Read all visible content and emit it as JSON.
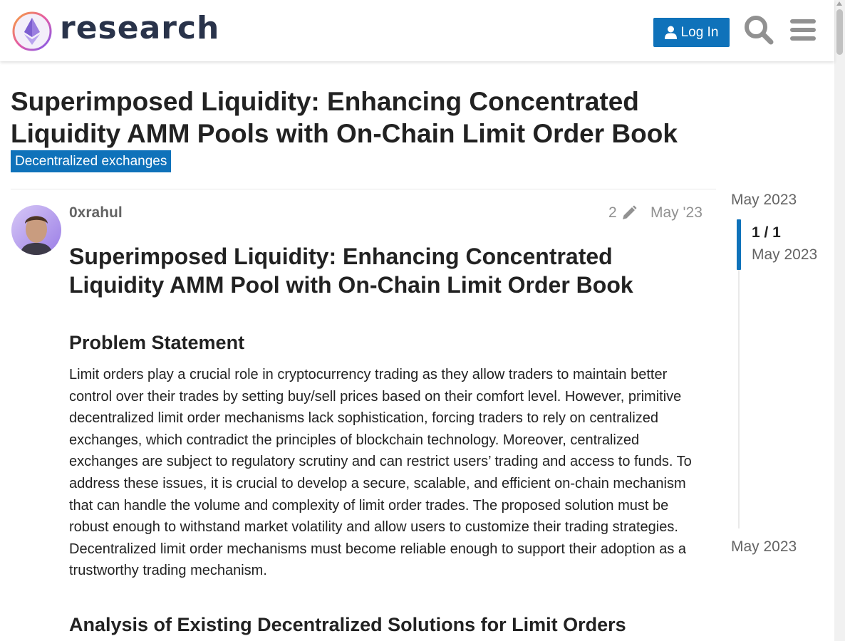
{
  "header": {
    "logo_text": "research",
    "login_label": "Log In",
    "icons": [
      "search-icon",
      "hamburger-menu-icon",
      "user-icon"
    ]
  },
  "topic": {
    "title": "Superimposed Liquidity: Enhancing Concentrated Liquidity AMM Pools with On-Chain Limit Order Book",
    "category": "Decentralized exchanges"
  },
  "post": {
    "username": "0xrahul",
    "edit_count": "2",
    "date": "May '23",
    "heading": "Superimposed Liquidity: Enhancing Concentrated Liquidity AMM Pool with On-Chain Limit Order Book",
    "section1_heading": "Problem Statement",
    "section1_body": "Limit orders play a crucial role in cryptocurrency trading as they allow traders to maintain better control over their trades by setting buy/sell prices based on their comfort level. However, primitive decentralized limit order mechanisms lack sophistication, forcing traders to rely on centralized exchanges, which contradict the principles of blockchain technology. Moreover, centralized exchanges are subject to regulatory scrutiny and can restrict users’ trading and access to funds. To address these issues, it is crucial to develop a secure, scalable, and efficient on-chain mechanism that can handle the volume and complexity of limit order trades. The proposed solution must be robust enough to withstand market volatility and allow users to customize their trading strategies. Decentralized limit order mechanisms must become reliable enough to support their adoption as a trustworthy trading mechanism.",
    "section2_heading": "Analysis of Existing Decentralized Solutions for Limit Orders"
  },
  "timeline": {
    "start_label": "May 2023",
    "position": "1 / 1",
    "position_date": "May 2023",
    "end_label": "May 2023"
  },
  "colors": {
    "accent": "#0f72ba",
    "text": "#222222",
    "muted": "#919191"
  }
}
